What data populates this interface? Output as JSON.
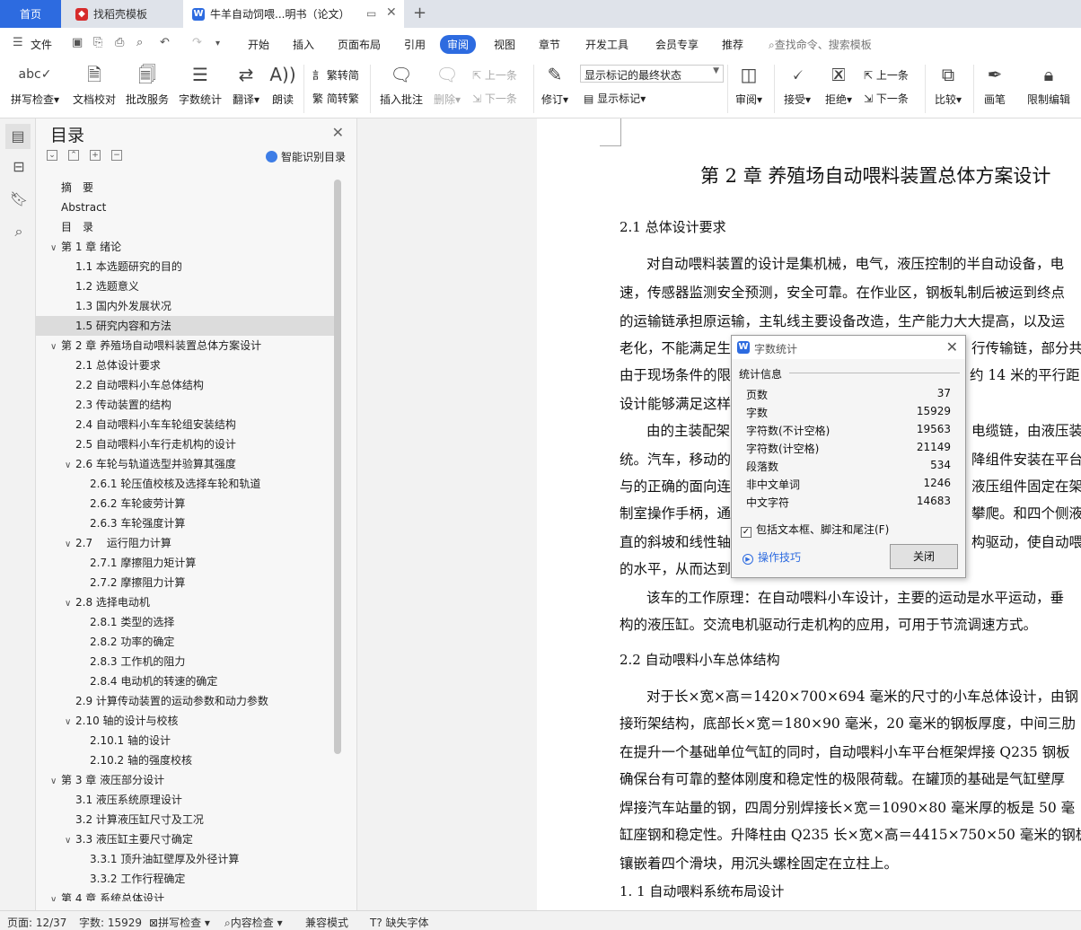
{
  "tabs": {
    "home": "首页",
    "template": "找稻壳模板",
    "document": "牛羊自动饲喂...明书（论文）"
  },
  "menu": {
    "file": "文件",
    "items": [
      "开始",
      "插入",
      "页面布局",
      "引用",
      "审阅",
      "视图",
      "章节",
      "开发工具",
      "会员专享",
      "推荐"
    ],
    "active": "审阅",
    "search_placeholder": "查找命令、搜索模板"
  },
  "ribbon": {
    "spell_check": "拼写检查",
    "doc_proof": "文档校对",
    "batch_service": "批改服务",
    "word_count": "字数统计",
    "translate": "翻译",
    "read_aloud": "朗读",
    "trad_to_simp": "繁转简",
    "simp_to_trad": "简转繁",
    "insert_comment": "插入批注",
    "delete": "删除",
    "previous": "上一条",
    "next": "下一条",
    "revision": "修订",
    "markup_dropdown": "显示标记的最终状态",
    "show_markup": "显示标记",
    "review": "审阅",
    "accept": "接受",
    "reject": "拒绝",
    "prev_change": "上一条",
    "next_change": "下一条",
    "compare": "比较",
    "pen": "画笔",
    "restrict_edit": "限制编辑"
  },
  "toc": {
    "title": "目录",
    "smart_label": "智能识别目录",
    "items": [
      {
        "text": "摘　要",
        "level": 0,
        "caret": ""
      },
      {
        "text": "Abstract",
        "level": 0,
        "caret": ""
      },
      {
        "text": "目　录",
        "level": 0,
        "caret": ""
      },
      {
        "text": "第 1 章  绪论",
        "level": 0,
        "caret": "v"
      },
      {
        "text": "1.1 本选题研究的目的",
        "level": 1,
        "caret": ""
      },
      {
        "text": "1.2 选题意义",
        "level": 1,
        "caret": ""
      },
      {
        "text": "1.3 国内外发展状况",
        "level": 1,
        "caret": ""
      },
      {
        "text": "1.5 研究内容和方法",
        "level": 1,
        "caret": "",
        "selected": true
      },
      {
        "text": "第 2 章  养殖场自动喂料装置总体方案设计",
        "level": 0,
        "caret": "v"
      },
      {
        "text": "2.1  总体设计要求",
        "level": 1,
        "caret": ""
      },
      {
        "text": "2.2  自动喂料小车总体结构",
        "level": 1,
        "caret": ""
      },
      {
        "text": "2.3  传动装置的结构",
        "level": 1,
        "caret": ""
      },
      {
        "text": "2.4  自动喂料小车车轮组安装结构",
        "level": 1,
        "caret": ""
      },
      {
        "text": "2.5 自动喂料小车行走机构的设计",
        "level": 1,
        "caret": ""
      },
      {
        "text": "2.6 车轮与轨道选型并验算其强度",
        "level": 1,
        "caret": "v"
      },
      {
        "text": "2.6.1 轮压值校核及选择车轮和轨道",
        "level": 2,
        "caret": ""
      },
      {
        "text": "2.6.2 车轮疲劳计算",
        "level": 2,
        "caret": ""
      },
      {
        "text": "2.6.3 车轮强度计算",
        "level": 2,
        "caret": ""
      },
      {
        "text": "2.7　 运行阻力计算",
        "level": 1,
        "caret": "v"
      },
      {
        "text": "2.7.1 摩擦阻力矩计算",
        "level": 2,
        "caret": ""
      },
      {
        "text": "2.7.2 摩擦阻力计算",
        "level": 2,
        "caret": ""
      },
      {
        "text": "2.8  选择电动机",
        "level": 1,
        "caret": "v"
      },
      {
        "text": "2.8.1 类型的选择",
        "level": 2,
        "caret": ""
      },
      {
        "text": "2.8.2 功率的确定",
        "level": 2,
        "caret": ""
      },
      {
        "text": "2.8.3 工作机的阻力",
        "level": 2,
        "caret": ""
      },
      {
        "text": "2.8.4 电动机的转速的确定",
        "level": 2,
        "caret": ""
      },
      {
        "text": "2.9 计算传动装置的运动参数和动力参数",
        "level": 1,
        "caret": ""
      },
      {
        "text": "2.10 轴的设计与校核",
        "level": 1,
        "caret": "v"
      },
      {
        "text": "2.10.1 轴的设计",
        "level": 2,
        "caret": ""
      },
      {
        "text": "2.10.2  轴的强度校核",
        "level": 2,
        "caret": ""
      },
      {
        "text": "第 3 章  液压部分设计",
        "level": 0,
        "caret": "v"
      },
      {
        "text": "3.1  液压系统原理设计",
        "level": 1,
        "caret": ""
      },
      {
        "text": "3.2 计算液压缸尺寸及工况",
        "level": 1,
        "caret": ""
      },
      {
        "text": "3.3 液压缸主要尺寸确定",
        "level": 1,
        "caret": "v"
      },
      {
        "text": "3.3.1 顶升油缸壁厚及外径计算",
        "level": 2,
        "caret": ""
      },
      {
        "text": "3.3.2 工作行程确定",
        "level": 2,
        "caret": ""
      },
      {
        "text": "第 4 章  系统总体设计",
        "level": 0,
        "caret": "v"
      }
    ]
  },
  "document": {
    "heading": "第 2 章  养殖场自动喂料装置总体方案设计",
    "section_21": "2.1  总体设计要求",
    "paragraph1": [
      "对自动喂料装置的设计是集机械，电气，液压控制的半自动设备，电",
      "速，传感器监测安全预测，安全可靠。在作业区，钢板轧制后被运到终点",
      "的运输链承担原运输，主轧线主要设备改造，生产能力大大提高，以及运",
      "老化，不能满足生",
      "由于现场条件的限",
      "设计能够满足这样"
    ],
    "paragraph1_right": [
      "行传输链，部分共",
      "约 14 米的平行距"
    ],
    "paragraph2": [
      "由的主装配架",
      "统。汽车，移动的",
      "与的正确的面向连",
      "制室操作手柄，通",
      "直的斜坡和线性轴",
      "的水平，从而达到"
    ],
    "paragraph2_right": [
      "电缆链，由液压装",
      "降组件安装在平台",
      "液压组件固定在架",
      "攀爬。和四个侧液",
      "构驱动，使自动喂"
    ],
    "paragraph3": [
      "该车的工作原理：在自动喂料小车设计，主要的运动是水平运动，垂",
      "构的液压缸。交流电机驱动行走机构的应用，可用于节流调速方式。"
    ],
    "section_22": "2.2  自动喂料小车总体结构",
    "paragraph4": [
      "对于长×宽×高＝1420×700×694 毫米的尺寸的小车总体设计，由钢",
      "接珩架结构，底部长×宽＝180×90 毫米，20 毫米的钢板厚度，中间三肋",
      "在提升一个基础单位气缸的同时，自动喂料小车平台框架焊接 Q235 钢板",
      "确保台有可靠的整体刚度和稳定性的极限荷载。在罐顶的基础是气缸壁厚",
      "焊接汽车站量的钢，四周分别焊接长×宽＝1090×80 毫米厚的板是 50 毫",
      "缸座钢和稳定性。升降柱由 Q235 长×宽×高＝4415×750×50 毫米的钢板",
      "镶嵌着四个滑块，用沉头螺栓固定在立柱上。"
    ],
    "section_11": "1. 1  自动喂料系统布局设计"
  },
  "dialog": {
    "title": "字数统计",
    "group_label": "统计信息",
    "stats": [
      {
        "name": "页数",
        "value": "37"
      },
      {
        "name": "字数",
        "value": "15929"
      },
      {
        "name": "字符数(不计空格)",
        "value": "19563"
      },
      {
        "name": "字符数(计空格)",
        "value": "21149"
      },
      {
        "name": "段落数",
        "value": "534"
      },
      {
        "name": "非中文单词",
        "value": "1246"
      },
      {
        "name": "中文字符",
        "value": "14683"
      }
    ],
    "include_label": "包括文本框、脚注和尾注(F)",
    "include_checked": true,
    "tips_label": "操作技巧",
    "close_label": "关闭"
  },
  "status": {
    "page": "页面: 12/37",
    "words": "字数: 15929",
    "spell": "拼写检查",
    "content_check": "内容检查",
    "compat": "兼容模式",
    "missing_font": "缺失字体"
  },
  "colors": {
    "accent": "#2d6be0",
    "wps_red": "#d62b2b"
  }
}
